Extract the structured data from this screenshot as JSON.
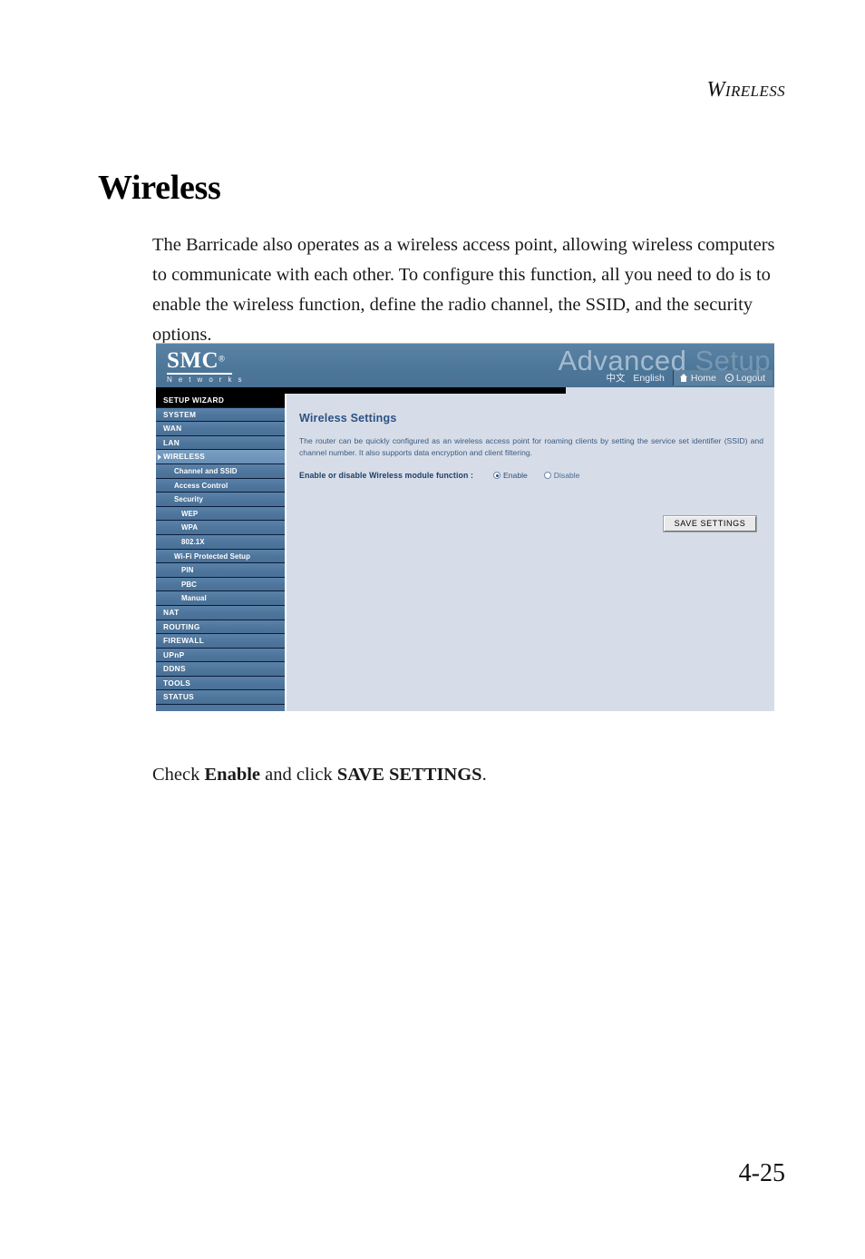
{
  "document": {
    "running_head": {
      "cap": "W",
      "rest": "IRELESS"
    },
    "title": "Wireless",
    "body_paragraph": "The Barricade also operates as a wireless access point, allowing wireless computers to communicate with each other. To configure this function, all you need to do is to enable the wireless function, define the radio channel, the SSID, and the security options.",
    "caption": {
      "part1": "Check ",
      "bold1": "Enable",
      "part2": " and click ",
      "bold2": "SAVE SETTINGS",
      "part3": "."
    },
    "page_number": "4-25"
  },
  "screenshot": {
    "banner": {
      "logo_word": "SMC",
      "logo_reg": "®",
      "logo_sub": "N e t w o r k s",
      "watermark_strong": "Advanced ",
      "watermark_fade": "Setup",
      "nav": {
        "chinese": "中文",
        "english": "English",
        "home": "Home",
        "logout": "Logout"
      }
    },
    "sidebar": {
      "items": [
        {
          "label": "SETUP WIZARD",
          "level": 0,
          "style": "wizard"
        },
        {
          "label": "SYSTEM",
          "level": 0,
          "style": "normal"
        },
        {
          "label": "WAN",
          "level": 0,
          "style": "normal"
        },
        {
          "label": "LAN",
          "level": 0,
          "style": "normal"
        },
        {
          "label": "WIRELESS",
          "level": 0,
          "style": "active"
        },
        {
          "label": "Channel and SSID",
          "level": 1,
          "style": "normal"
        },
        {
          "label": "Access Control",
          "level": 1,
          "style": "normal"
        },
        {
          "label": "Security",
          "level": 1,
          "style": "normal"
        },
        {
          "label": "WEP",
          "level": 2,
          "style": "normal"
        },
        {
          "label": "WPA",
          "level": 2,
          "style": "normal"
        },
        {
          "label": "802.1X",
          "level": 2,
          "style": "normal"
        },
        {
          "label": "Wi-Fi Protected Setup",
          "level": 1,
          "style": "normal"
        },
        {
          "label": "PIN",
          "level": 2,
          "style": "normal"
        },
        {
          "label": "PBC",
          "level": 2,
          "style": "normal"
        },
        {
          "label": "Manual",
          "level": 2,
          "style": "normal"
        },
        {
          "label": "NAT",
          "level": 0,
          "style": "normal"
        },
        {
          "label": "ROUTING",
          "level": 0,
          "style": "normal"
        },
        {
          "label": "FIREWALL",
          "level": 0,
          "style": "normal"
        },
        {
          "label": "UPnP",
          "level": 0,
          "style": "normal"
        },
        {
          "label": "DDNS",
          "level": 0,
          "style": "normal"
        },
        {
          "label": "TOOLS",
          "level": 0,
          "style": "normal"
        },
        {
          "label": "STATUS",
          "level": 0,
          "style": "normal"
        }
      ]
    },
    "content": {
      "title": "Wireless Settings",
      "description": "The router can be quickly configured as an wireless access point for roaming clients by setting the service set identifier (SSID) and channel number. It also supports data encryption and client filtering.",
      "field_label": "Enable or disable Wireless module function :",
      "radio_enable": "Enable",
      "radio_disable": "Disable",
      "selected": "Enable",
      "save_button": "SAVE SETTINGS"
    }
  },
  "colors": {
    "banner_blue": "#4d7799",
    "sidebar_blue": "#4f769c",
    "sidebar_active": "#6f95ba",
    "content_bg": "#d7dde8",
    "heading_blue": "#2a5183",
    "separator_navy": "#0d1c3a"
  }
}
